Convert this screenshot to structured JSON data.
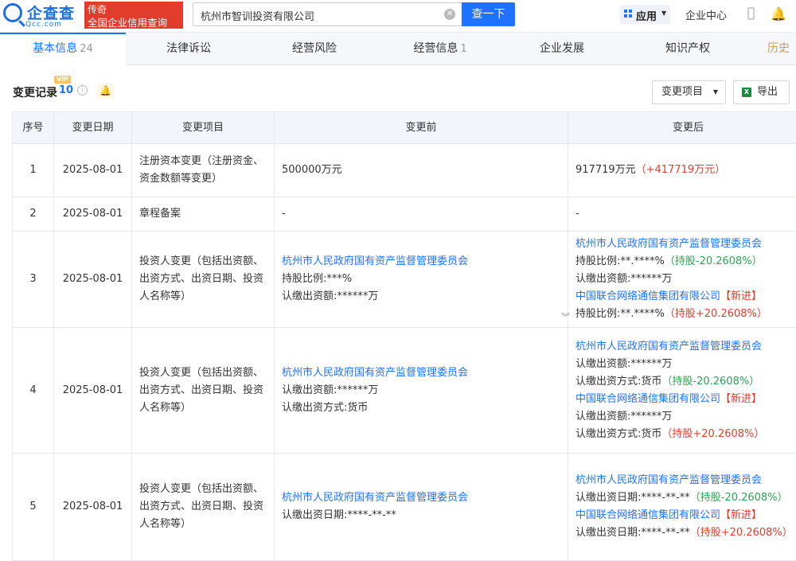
{
  "brand": {
    "name": "企查查",
    "domain": "Qcc.com"
  },
  "ad": {
    "line1": "传奇",
    "line2": "全国企业信用查询"
  },
  "search": {
    "value": "杭州市智训投资有限公司",
    "button": "查一下",
    "clear_icon": "clear-icon"
  },
  "header": {
    "apps_label": "应用",
    "center_label": "企业中心"
  },
  "tabs": [
    {
      "label": "基本信息",
      "count": "24"
    },
    {
      "label": "法律诉讼",
      "count": ""
    },
    {
      "label": "经营风险",
      "count": ""
    },
    {
      "label": "经营信息",
      "count": "1"
    },
    {
      "label": "企业发展",
      "count": ""
    },
    {
      "label": "知识产权",
      "count": ""
    },
    {
      "label": "历史",
      "count": ""
    }
  ],
  "section": {
    "title": "变更记录",
    "count": "10",
    "vip": "VIP",
    "info": "i"
  },
  "toolbar": {
    "filter_label": "变更项目",
    "export_label": "导出",
    "export_icon_text": "X"
  },
  "table": {
    "headers": [
      "序号",
      "变更日期",
      "变更项目",
      "变更前",
      "变更后"
    ],
    "rows": [
      {
        "no": "1",
        "date": "2025-08-01",
        "item": "注册资本变更（注册资金、资金数额等变更）",
        "before": [
          {
            "text": "500000万元",
            "cls": ""
          }
        ],
        "after": [
          {
            "text": "917719万元",
            "cls": "",
            "extra": "（+417719万元）",
            "extra_cls": "red"
          }
        ]
      },
      {
        "no": "2",
        "date": "2025-08-01",
        "item": "章程备案",
        "before": [
          {
            "text": "-",
            "cls": ""
          }
        ],
        "after": [
          {
            "text": "-",
            "cls": ""
          }
        ]
      },
      {
        "no": "3",
        "date": "2025-08-01",
        "item": "投资人变更（包括出资额、出资方式、出资日期、投资人名称等）",
        "before": [
          {
            "text": "杭州市人民政府国有资产监督管理委员会",
            "cls": "link"
          },
          {
            "text": "持股比例:***%",
            "cls": ""
          },
          {
            "text": "认缴出资额:******万",
            "cls": ""
          }
        ],
        "after": [
          {
            "text": "杭州市人民政府国有资产监督管理委员会",
            "cls": "link"
          },
          {
            "text": "持股比例:**.****%",
            "cls": "",
            "extra": "（持股-20.2608%）",
            "extra_cls": "green"
          },
          {
            "text": "认缴出资额:******万",
            "cls": ""
          },
          {
            "text": "中国联合网络通信集团有限公司",
            "cls": "link",
            "extra": "【新进】",
            "extra_cls": "red"
          },
          {
            "text": "持股比例:**.****%",
            "cls": "",
            "extra": "（持股+20.2608%）",
            "extra_cls": "red"
          }
        ]
      },
      {
        "no": "4",
        "date": "2025-08-01",
        "item": "投资人变更（包括出资额、出资方式、出资日期、投资人名称等）",
        "before": [
          {
            "text": "杭州市人民政府国有资产监督管理委员会",
            "cls": "link"
          },
          {
            "text": "认缴出资额:******万",
            "cls": ""
          },
          {
            "text": "认缴出资方式:货币",
            "cls": ""
          }
        ],
        "after": [
          {
            "text": "杭州市人民政府国有资产监督管理委员会",
            "cls": "link"
          },
          {
            "text": "认缴出资额:******万",
            "cls": ""
          },
          {
            "text": "认缴出资方式:货币",
            "cls": "",
            "extra": "（持股-20.2608%）",
            "extra_cls": "green"
          },
          {
            "text": "中国联合网络通信集团有限公司",
            "cls": "link",
            "extra": "【新进】",
            "extra_cls": "red"
          },
          {
            "text": "认缴出资额:******万",
            "cls": ""
          },
          {
            "text": "认缴出资方式:货币",
            "cls": "",
            "extra": "（持股+20.2608%）",
            "extra_cls": "red"
          }
        ]
      },
      {
        "no": "5",
        "date": "2025-08-01",
        "item": "投资人变更（包括出资额、出资方式、出资日期、投资人名称等）",
        "before": [
          {
            "text": "杭州市人民政府国有资产监督管理委员会",
            "cls": "link"
          },
          {
            "text": "认缴出资日期:****-**-**",
            "cls": ""
          }
        ],
        "after": [
          {
            "text": "杭州市人民政府国有资产监督管理委员会",
            "cls": "link"
          },
          {
            "text": "认缴出资日期:****-**-**",
            "cls": "",
            "extra": "（持股-20.2608%）",
            "extra_cls": "green"
          },
          {
            "text": "中国联合网络通信集团有限公司",
            "cls": "link",
            "extra": "【新进】",
            "extra_cls": "red"
          },
          {
            "text": "认缴出资日期:****-**-**",
            "cls": "",
            "extra": "（持股+20.2608%）",
            "extra_cls": "red"
          }
        ]
      }
    ]
  }
}
